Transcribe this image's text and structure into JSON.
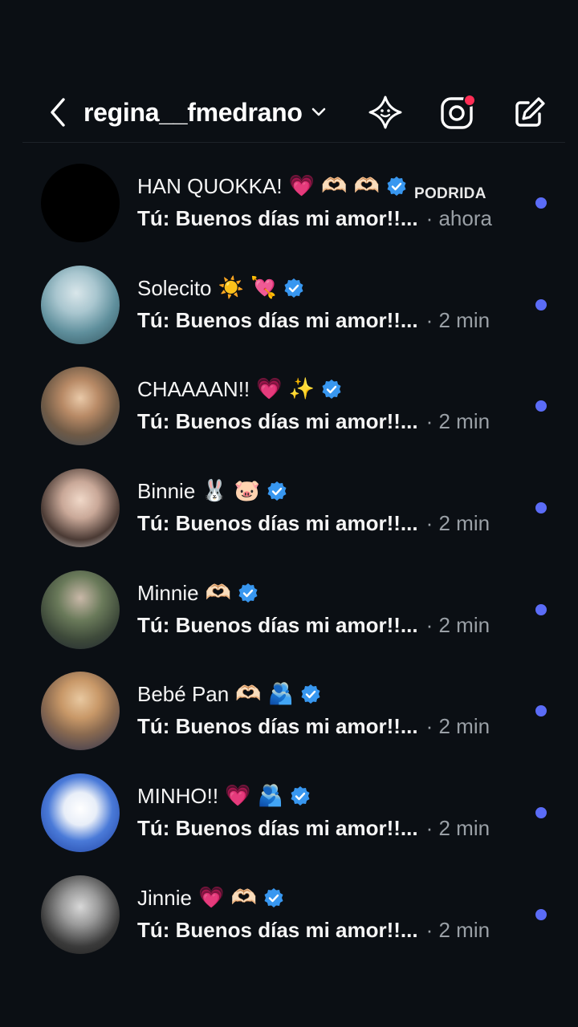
{
  "header": {
    "username": "regina__fmedrano",
    "notification_color": "#ff2d55"
  },
  "tag_label": "PODRIDA",
  "conversations": [
    {
      "name": "HAN QUOKKA!",
      "emojis": "💗 🫶🏻 🫶🏻",
      "verified": true,
      "message": "Tú: Buenos días mi amor!!...",
      "time": "· ahora",
      "unread": true
    },
    {
      "name": "Solecito",
      "emojis": "☀️ 💘",
      "verified": true,
      "message": "Tú: Buenos días mi amor!!...",
      "time": "· 2 min",
      "unread": true
    },
    {
      "name": "CHAAAAN!!",
      "emojis": "💗 ✨",
      "verified": true,
      "message": "Tú: Buenos días mi amor!!...",
      "time": "· 2 min",
      "unread": true
    },
    {
      "name": "Binnie",
      "emojis": "🐰 🐷",
      "verified": true,
      "message": "Tú: Buenos días mi amor!!...",
      "time": "· 2 min",
      "unread": true
    },
    {
      "name": "Minnie",
      "emojis": "🫶🏻",
      "verified": true,
      "message": "Tú: Buenos días mi amor!!...",
      "time": "· 2 min",
      "unread": true
    },
    {
      "name": "Bebé Pan",
      "emojis": "🫶🏻 🫂",
      "verified": true,
      "message": "Tú: Buenos días mi amor!!...",
      "time": "· 2 min",
      "unread": true
    },
    {
      "name": "MINHO!!",
      "emojis": "💗 🫂",
      "verified": true,
      "message": "Tú: Buenos días mi amor!!...",
      "time": "· 2 min",
      "unread": true
    },
    {
      "name": "Jinnie",
      "emojis": "💗 🫶🏻",
      "verified": true,
      "message": "Tú: Buenos días mi amor!!...",
      "time": "· 2 min",
      "unread": true
    }
  ],
  "colors": {
    "background": "#0b0f14",
    "verified_badge": "#3897f0",
    "unread_dot": "#5b6cf7",
    "secondary_text": "#9aa0a6"
  }
}
